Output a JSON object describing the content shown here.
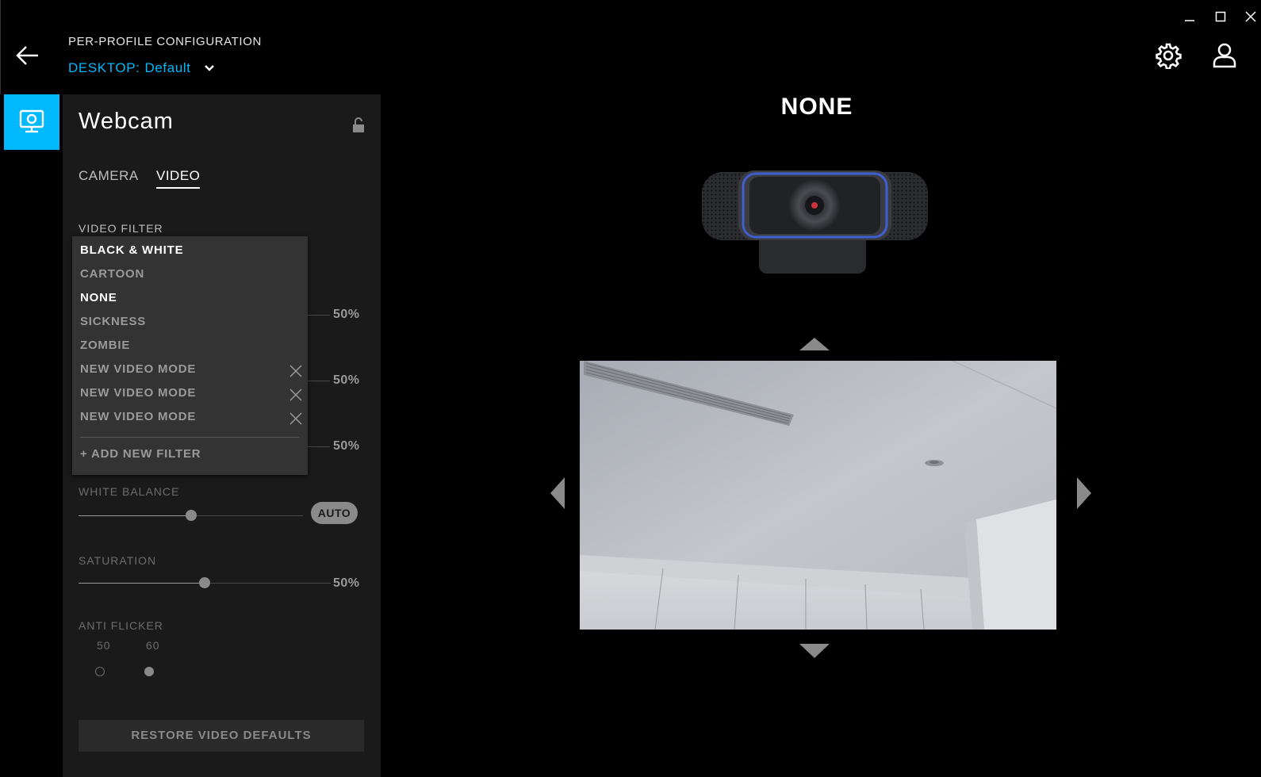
{
  "window": {
    "minimize_icon": "minimize-icon",
    "maximize_icon": "maximize-icon",
    "close_icon": "close-icon"
  },
  "header": {
    "title": "PER-PROFILE CONFIGURATION",
    "profile_key": "DESKTOP:",
    "profile_value": "Default",
    "back_icon": "arrow-left-icon",
    "settings_icon": "gear-icon",
    "account_icon": "user-icon"
  },
  "panel": {
    "title": "Webcam",
    "tabs": [
      {
        "label": "CAMERA",
        "active": false
      },
      {
        "label": "VIDEO",
        "active": true
      }
    ],
    "video_filter_label": "VIDEO FILTER",
    "hidden_slider_values": [
      "50%",
      "50%",
      "50%"
    ],
    "white_balance": {
      "label": "WHITE BALANCE",
      "value": 0.5,
      "auto_label": "AUTO"
    },
    "saturation": {
      "label": "SATURATION",
      "value": 0.5,
      "value_label": "50%"
    },
    "anti_flicker": {
      "label": "ANTI FLICKER",
      "options": [
        "50",
        "60"
      ],
      "selected": "60"
    },
    "restore_label": "RESTORE VIDEO DEFAULTS"
  },
  "filter_dropdown": {
    "items": [
      {
        "label": "BLACK & WHITE",
        "highlighted": true,
        "removable": false
      },
      {
        "label": "CARTOON",
        "highlighted": false,
        "removable": false
      },
      {
        "label": "NONE",
        "highlighted": true,
        "removable": false
      },
      {
        "label": "SICKNESS",
        "highlighted": false,
        "removable": false
      },
      {
        "label": "ZOMBIE",
        "highlighted": false,
        "removable": false
      },
      {
        "label": "NEW VIDEO MODE",
        "highlighted": false,
        "removable": true
      },
      {
        "label": "NEW VIDEO MODE",
        "highlighted": false,
        "removable": true
      },
      {
        "label": "NEW VIDEO MODE",
        "highlighted": false,
        "removable": true
      }
    ],
    "add_label": "+ ADD NEW FILTER"
  },
  "preview": {
    "mode_title": "NONE"
  },
  "colors": {
    "accent": "#00b8fc",
    "panel_bg": "#1a1a1a",
    "dropdown_bg": "#333333"
  }
}
